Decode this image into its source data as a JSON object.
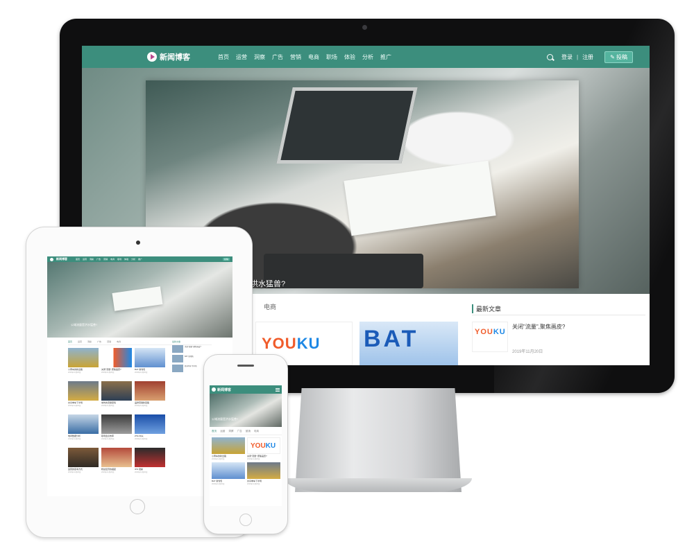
{
  "desktop": {
    "logo": "新闻博客",
    "menu": [
      "首页",
      "运营",
      "洞察",
      "广告",
      "营销",
      "电商",
      "职场",
      "体验",
      "分析",
      "推广"
    ],
    "login": "登录",
    "divider": "|",
    "register": "注册",
    "post_button": "投稿",
    "hero_caption": "是洪水猛兽?",
    "tab_fragment": "商",
    "tab_ecommerce": "电商",
    "sidebar_title": "最新文章",
    "sidebar_article_title": "关闭\"流量\",聚焦画皮?",
    "sidebar_article_date": "2019年11月20日",
    "youku_text_a": "YOU",
    "youku_text_b": "KU",
    "bat_text": "BAT"
  },
  "tablet": {
    "logo": "新闻博客",
    "menu": [
      "首页",
      "运营",
      "洞察",
      "广告",
      "营销",
      "电商",
      "职场",
      "体验",
      "分析",
      "推广"
    ],
    "post_button": "投稿",
    "hero_caption": "公域流量是洪水猛兽?",
    "tabs": [
      "首页",
      "运营",
      "洞察",
      "广告",
      "营销",
      "电商"
    ],
    "cards": [
      {
        "caption": "小黄车的新出路",
        "date": "2019年11月20日"
      },
      {
        "caption": "关闭\"流量\",聚焦画皮?",
        "date": "2019年11月20日"
      },
      {
        "caption": "BAT 新零售",
        "date": "2019年11月20日"
      },
      {
        "caption": "共享单车下半场",
        "date": "2019年11月20日"
      },
      {
        "caption": "城市的流量密码",
        "date": "2019年11月20日"
      },
      {
        "caption": "品牌营销新思路",
        "date": "2019年11月20日"
      },
      {
        "caption": "电商数据分析",
        "date": "2019年11月20日"
      },
      {
        "caption": "职场会议效率",
        "date": "2019年11月20日"
      },
      {
        "caption": "ZTE 中兴",
        "date": "2019年11月20日"
      },
      {
        "caption": "运营的思考方式",
        "date": "2019年11月20日"
      },
      {
        "caption": "粉丝经济的崛起",
        "date": "2019年11月20日"
      },
      {
        "caption": "IPO 观察",
        "date": "2019年11月20日"
      }
    ],
    "sidebar_title": "最新文章",
    "sidebar_items": [
      "关闭\"流量\",聚焦画皮?",
      "BAT 新零售",
      "共享单车下半场"
    ]
  },
  "phone": {
    "logo": "新闻博客",
    "hero_caption": "公域流量是洪水猛兽?",
    "tabs": [
      "首页",
      "运营",
      "洞察",
      "广告",
      "营销",
      "电商"
    ],
    "cards": [
      {
        "caption": "小黄车的新出路",
        "date": "2019年11月20日"
      },
      {
        "caption": "关闭\"流量\",聚焦画皮?",
        "date": "2019年11月20日"
      },
      {
        "caption": "BAT 新零售",
        "date": "2019年11月20日"
      },
      {
        "caption": "共享单车下半场",
        "date": "2019年11月20日"
      }
    ]
  },
  "colors": {
    "brand_green": "#3c8e7d",
    "accent_light_green": "#54b39e",
    "youku_orange": "#f05c2b",
    "youku_blue": "#1e88e5"
  }
}
